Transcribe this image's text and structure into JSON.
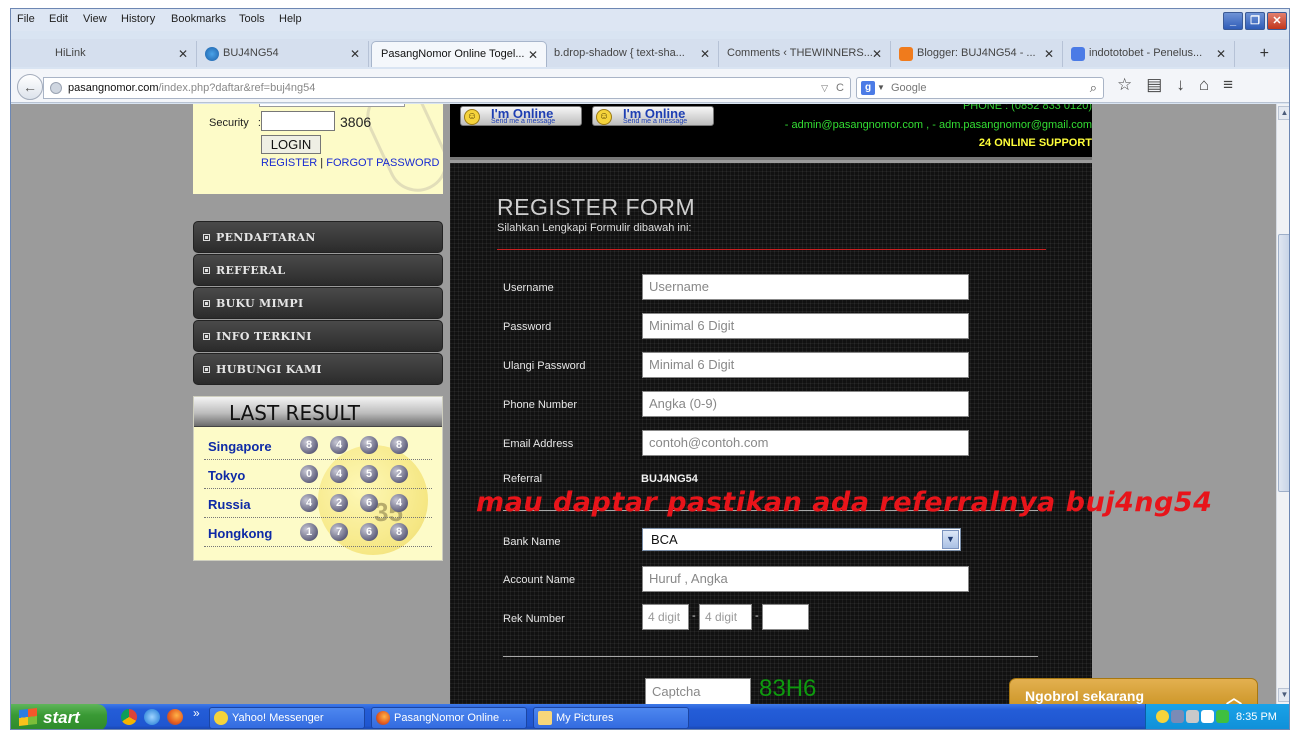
{
  "menubar": {
    "items": [
      "File",
      "Edit",
      "View",
      "History",
      "Bookmarks",
      "Tools",
      "Help"
    ]
  },
  "window_controls": {
    "minimize": "_",
    "restore": "❐",
    "close": "✕"
  },
  "tabs": [
    {
      "label": "HiLink",
      "icon": "blank-page-icon"
    },
    {
      "label": "BUJ4NG54",
      "icon": "globe-icon"
    },
    {
      "label": "PasangNomor Online Togel...",
      "icon": "none",
      "active": true
    },
    {
      "label": "b.drop-shadow { text-sha...",
      "icon": "none"
    },
    {
      "label": "Comments ‹ THEWINNERS...",
      "icon": "none"
    },
    {
      "label": "Blogger: BUJ4NG54 - ...",
      "icon": "blogger-icon"
    },
    {
      "label": "indototobet - Penelus...",
      "icon": "google-icon"
    }
  ],
  "tab_close_glyph": "✕",
  "new_tab_glyph": "+",
  "nav": {
    "back_glyph": "←",
    "url_host": "pasangnomor.com",
    "url_path": "/index.php?daftar&ref=buj4ng54",
    "dropdown_glyph": "▽",
    "reload_glyph": "C",
    "search_engine_letter": "g",
    "search_placeholder": "Google",
    "search_glyph": "⌕",
    "toolbar_icons": [
      "☆",
      "▤",
      "↓",
      "⌂",
      "≡"
    ]
  },
  "login": {
    "security_label": "Security",
    "colon": ":",
    "security_code": "3806",
    "login_button": "LOGIN",
    "register_link": "REGISTER",
    "separator": "|",
    "forgot_link": "FORGOT PASSWORD"
  },
  "side_menu": [
    "PENDAFTARAN",
    "REFFERAL",
    "BUKU MIMPI",
    "INFO TERKINI",
    "HUBUNGI KAMI"
  ],
  "last_result": {
    "title": "LAST RESULT",
    "deco_number": "35",
    "rows": [
      {
        "city": "Singapore",
        "numbers": [
          "8",
          "4",
          "5",
          "8"
        ]
      },
      {
        "city": "Tokyo",
        "numbers": [
          "0",
          "4",
          "5",
          "2"
        ]
      },
      {
        "city": "Russia",
        "numbers": [
          "4",
          "2",
          "6",
          "4"
        ]
      },
      {
        "city": "Hongkong",
        "numbers": [
          "1",
          "7",
          "6",
          "8"
        ]
      }
    ]
  },
  "banner": {
    "chip_title": "I'm Online",
    "chip_sub": "Send me a message",
    "phone": "PHONE : (0852 833 0120)",
    "emails": "- admin@pasangnomor.com , - adm.pasangnomor@gmail.com",
    "support": "24 ONLINE SUPPORT"
  },
  "form": {
    "title": "REGISTER FORM",
    "subtitle": "Silahkan Lengkapi Formulir dibawah ini:",
    "fields": [
      {
        "label": "Username",
        "placeholder": "Username"
      },
      {
        "label": "Password",
        "placeholder": "Minimal 6 Digit"
      },
      {
        "label": "Ulangi Password",
        "placeholder": "Minimal 6 Digit"
      },
      {
        "label": "Phone Number",
        "placeholder": "Angka (0-9)"
      },
      {
        "label": "Email Address",
        "placeholder": "contoh@contoh.com"
      }
    ],
    "referral_label": "Referral",
    "referral_value": "BUJ4NG54",
    "overlay_text": "mau daptar pastikan ada referralnya buj4ng54",
    "bank_label": "Bank Name",
    "bank_value": "BCA",
    "account_label": "Account Name",
    "account_placeholder": "Huruf , Angka",
    "rek_label": "Rek Number",
    "rek_placeholder_1": "4 digit",
    "rek_placeholder_2": "4 digit",
    "rek_placeholder_3": "",
    "rek_dash": "-",
    "captcha_placeholder": "Captcha",
    "captcha_code": "83H6"
  },
  "chat": {
    "label": "Ngobrol sekarang",
    "chevron": "︿"
  },
  "taskbar": {
    "start": "start",
    "overflow": "»",
    "items": [
      {
        "label": "Yahoo! Messenger",
        "icon": "yahoo-smiley-icon"
      },
      {
        "label": "PasangNomor Online ...",
        "icon": "firefox-icon"
      },
      {
        "label": "My Pictures",
        "icon": "folder-icon"
      }
    ],
    "clock": "8:35 PM"
  }
}
